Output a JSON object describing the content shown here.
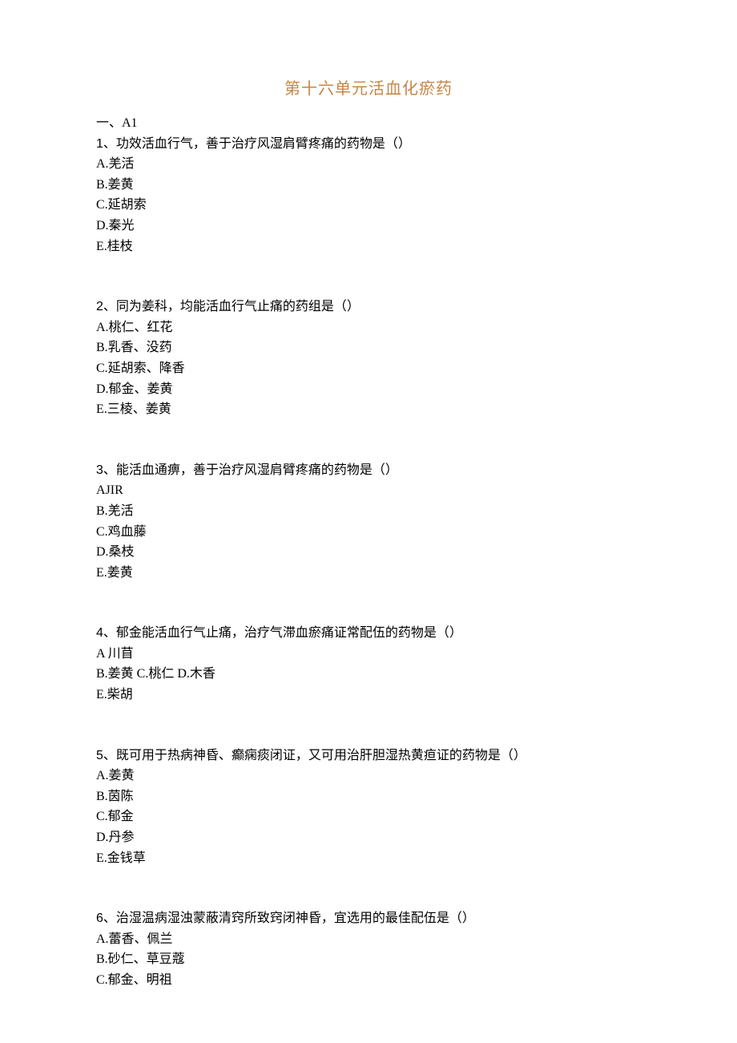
{
  "title": "第十六单元活血化瘀药",
  "section": "一、A1",
  "questions": [
    {
      "number": "1",
      "stem": "、功效活血行气，善于治疗风湿肩臂疼痛的药物是（）",
      "options": [
        "A.羌活",
        "B.姜黄",
        "C.延胡索",
        "D.秦光",
        "E.桂枝"
      ]
    },
    {
      "number": "2",
      "stem": "、同为姜科，均能活血行气止痛的药组是（）",
      "options": [
        "A.桃仁、红花",
        "B.乳香、没药",
        "C.延胡索、降香",
        "D.郁金、姜黄",
        "E.三棱、姜黄"
      ]
    },
    {
      "number": "3",
      "stem": "、能活血通痹，善于治疗风湿肩臂疼痛的药物是（）",
      "options": [
        "AJIR",
        "B.羌活",
        "C.鸡血藤",
        "D.桑枝",
        "E.姜黄"
      ]
    },
    {
      "number": "4",
      "stem": "、郁金能活血行气止痛，治疗气滞血瘀痛证常配伍的药物是（）",
      "options": [
        "A 川苜",
        "B.姜黄 C.桃仁 D.木香",
        "E.柴胡"
      ]
    },
    {
      "number": "5",
      "stem": "、既可用于热病神昏、癫痫痰闭证，又可用治肝胆湿热黄疸证的药物是（）",
      "options": [
        "A.姜黄",
        "B.茵陈",
        "C.郁金",
        "D.丹参",
        "E.金钱草"
      ]
    },
    {
      "number": "6",
      "stem": "、治湿温病湿浊蒙蔽清窍所致窍闭神昏，宜选用的最佳配伍是（）",
      "options": [
        "A.蕾香、佩兰",
        "B.砂仁、草豆蔻",
        "C.郁金、明祖"
      ]
    }
  ]
}
